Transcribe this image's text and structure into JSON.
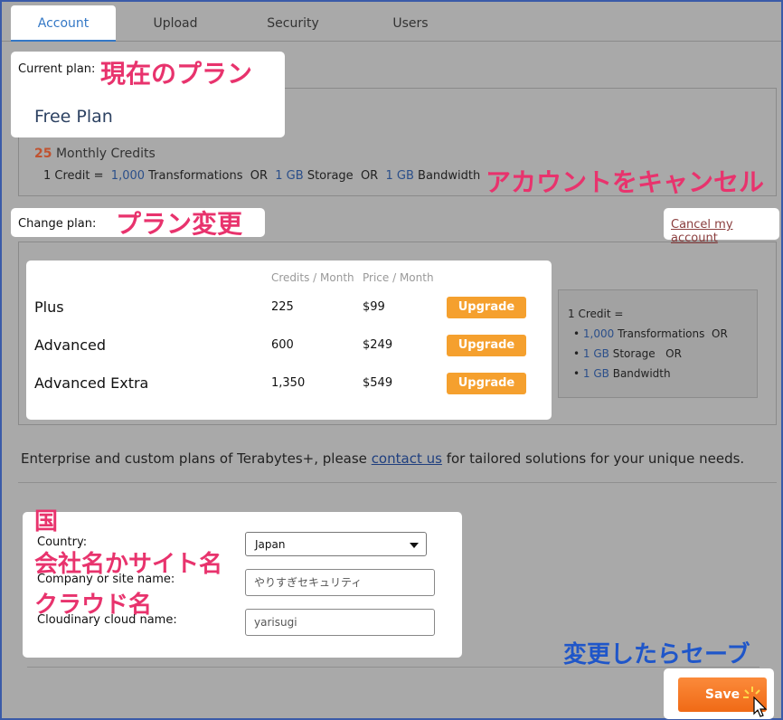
{
  "tabs": [
    {
      "label": "Account",
      "active": true
    },
    {
      "label": "Upload",
      "active": false
    },
    {
      "label": "Security",
      "active": false
    },
    {
      "label": "Users",
      "active": false
    }
  ],
  "current_plan": {
    "label": "Current plan:",
    "annotation": "現在のプラン",
    "plan_name": "Free Plan",
    "credits_count": "25",
    "credits_text": "Monthly Credits",
    "credit_eq": {
      "prefix": "1 Credit =",
      "transform_num": "1,000",
      "transform_text": "Transformations",
      "or1": "OR",
      "storage_num": "1 GB",
      "storage_text": "Storage",
      "or2": "OR",
      "bandwidth_num": "1 GB",
      "bandwidth_text": "Bandwidth"
    }
  },
  "cancel": {
    "annotation": "アカウントをキャンセル",
    "link": "Cancel my account"
  },
  "change_plan": {
    "label": "Change plan:",
    "annotation": "プラン変更",
    "col_credits": "Credits / Month",
    "col_price": "Price / Month",
    "plans": [
      {
        "name": "Plus",
        "credits": "225",
        "price": "$99",
        "button": "Upgrade"
      },
      {
        "name": "Advanced",
        "credits": "600",
        "price": "$249",
        "button": "Upgrade"
      },
      {
        "name": "Advanced Extra",
        "credits": "1,350",
        "price": "$549",
        "button": "Upgrade"
      }
    ],
    "side_info": {
      "line1": "1 Credit =",
      "b1_num": "1,000",
      "b1_text": "Transformations",
      "b1_or": "OR",
      "b2_num": "1 GB",
      "b2_text": "Storage",
      "b2_or": "OR",
      "b3_num": "1 GB",
      "b3_text": "Bandwidth"
    }
  },
  "enterprise": {
    "before": "Enterprise and custom plans of Terabytes+, please",
    "link": "contact us",
    "after": "for tailored solutions for your unique needs."
  },
  "form": {
    "country_annotation": "国",
    "country_label": "Country:",
    "country_value": "Japan",
    "company_annotation": "会社名かサイト名",
    "company_label": "Company or site name:",
    "company_value": "やりすぎセキュリティ",
    "cloud_annotation": "クラウド名",
    "cloud_label": "Cloudinary cloud name:",
    "cloud_value": "yarisugi"
  },
  "save": {
    "annotation": "変更したらセーブ",
    "button": "Save"
  },
  "colors": {
    "accent_blue": "#3478c6",
    "upgrade_orange": "#f5a02e",
    "save_orange": "#f06a16",
    "annotation_pink": "#e8336d",
    "annotation_blue": "#1f56c9"
  }
}
